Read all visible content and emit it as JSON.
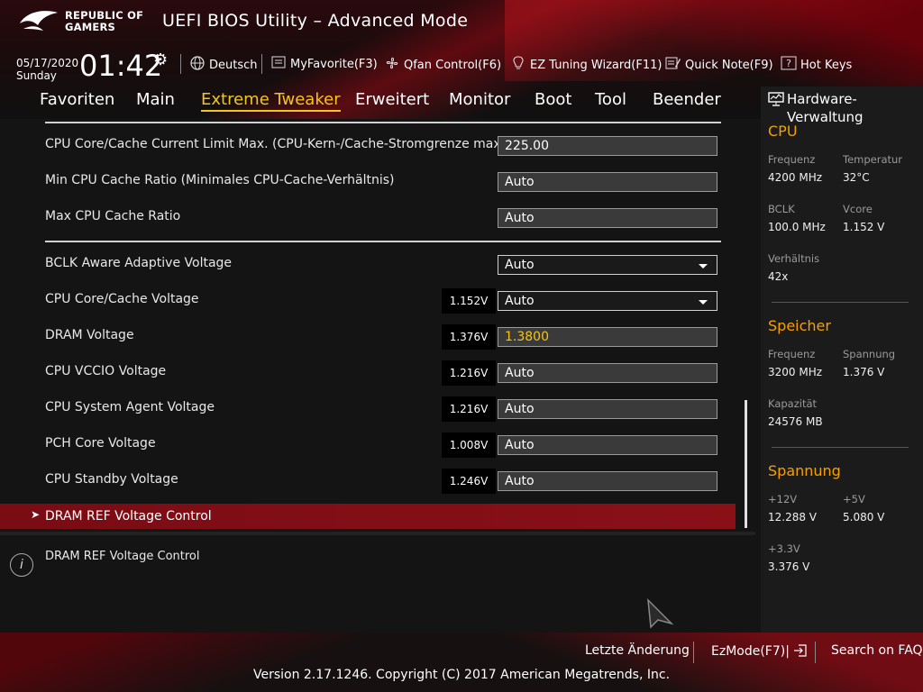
{
  "header": {
    "logo_line1": "REPUBLIC OF",
    "logo_line2": "GAMERS",
    "title": "UEFI BIOS Utility – Advanced Mode",
    "date": "05/17/2020",
    "day": "Sunday",
    "time": "01:42",
    "toolbar": {
      "language": "Deutsch",
      "myfavorite": "MyFavorite(F3)",
      "qfan": "Qfan Control(F6)",
      "ez_tuning": "EZ Tuning Wizard(F11)",
      "quick_note": "Quick Note(F9)",
      "hot_keys": "Hot Keys"
    }
  },
  "tabs": [
    "Favoriten",
    "Main",
    "Extreme Tweaker",
    "Erweitert",
    "Monitor",
    "Boot",
    "Tool",
    "Beender"
  ],
  "active_tab": "Extreme Tweaker",
  "settings": [
    {
      "label": "CPU Core/Cache Current Limit Max. (CPU-Kern-/Cache-Stromgrenze max.)",
      "value": "225.00",
      "current": ""
    },
    {
      "label": "Min CPU Cache Ratio (Minimales CPU-Cache-Verhältnis)",
      "value": "Auto",
      "current": ""
    },
    {
      "label": "Max CPU Cache Ratio",
      "value": "Auto",
      "current": ""
    },
    {
      "label": "BCLK Aware Adaptive Voltage",
      "value": "Auto",
      "current": ""
    },
    {
      "label": "CPU Core/Cache Voltage",
      "value": "Auto",
      "current": "1.152V"
    },
    {
      "label": "DRAM Voltage",
      "value": "1.3800",
      "current": "1.376V"
    },
    {
      "label": "CPU VCCIO Voltage",
      "value": "Auto",
      "current": "1.216V"
    },
    {
      "label": "CPU System Agent Voltage",
      "value": "Auto",
      "current": "1.216V"
    },
    {
      "label": "PCH Core Voltage",
      "value": "Auto",
      "current": "1.008V"
    },
    {
      "label": "CPU Standby Voltage",
      "value": "Auto",
      "current": "1.246V"
    }
  ],
  "selected_item": "DRAM REF Voltage Control",
  "description": "DRAM REF Voltage Control",
  "hardware": {
    "title": "Hardware-Verwaltung",
    "cpu": {
      "heading": "CPU",
      "freq_label": "Frequenz",
      "freq": "4200 MHz",
      "temp_label": "Temperatur",
      "temp": "32°C",
      "bclk_label": "BCLK",
      "bclk": "100.0 MHz",
      "vcore_label": "Vcore",
      "vcore": "1.152 V",
      "ratio_label": "Verhältnis",
      "ratio": "42x"
    },
    "memory": {
      "heading": "Speicher",
      "freq_label": "Frequenz",
      "freq": "3200 MHz",
      "volt_label": "Spannung",
      "volt": "1.376 V",
      "cap_label": "Kapazität",
      "cap": "24576 MB"
    },
    "voltage": {
      "heading": "Spannung",
      "v12_label": "+12V",
      "v12": "12.288 V",
      "v5_label": "+5V",
      "v5": "5.080 V",
      "v33_label": "+3.3V",
      "v33": "3.376 V"
    }
  },
  "footer": {
    "last_change": "Letzte Änderung",
    "ezmode": "EzMode(F7)|",
    "faq": "Search on FAQ",
    "copyright": "Version 2.17.1246. Copyright (C) 2017 American Megatrends, Inc."
  },
  "colors": {
    "accent": "#f5c518",
    "section": "#f5a000",
    "highlight_row": "#7a0c14"
  }
}
